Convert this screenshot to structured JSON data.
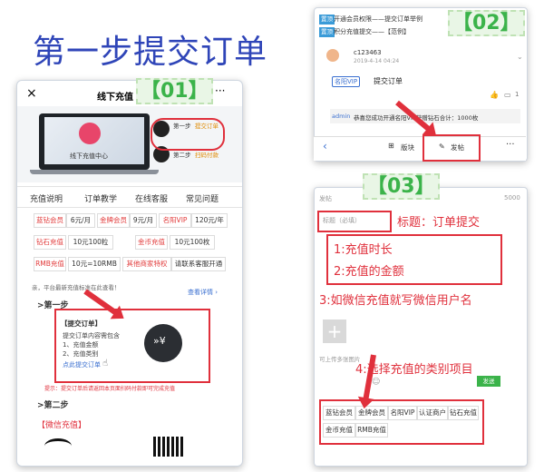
{
  "heading": "第一步提交订单",
  "labels": {
    "p1": "【01】",
    "p2": "【02】",
    "p3": "【03】"
  },
  "phone1": {
    "close": "×",
    "title": "线下充值",
    "more": "···",
    "laptop_caption": "线下充值中心",
    "step1_small": "第一步",
    "step1_text": "提交订单",
    "step2_small": "第二步",
    "step2_text": "扫码付款",
    "tabs": [
      "充值说明",
      "订单教学",
      "在线客服",
      "常见问题"
    ],
    "price_rows": [
      [
        "蓝钻会员",
        "6元/月",
        "金牌会员",
        "9元/月",
        "名阳VIP",
        "120元/年"
      ],
      [
        "钻石充值",
        "10元100粒",
        "",
        "金币充值",
        "10元100枚"
      ],
      [
        "RMB充值",
        "10元=10RMB",
        "其他商家特权",
        "请联系客服开通"
      ]
    ],
    "notice": "亲，平台最新充值标准在此查看！",
    "notice_link": "查看详情 ›",
    "step1_head": ">第一步",
    "card_title": "【提交订单】",
    "card_lines": [
      "提交订单内容需包含",
      "1、充值金额",
      "2、充值类别"
    ],
    "card_link": "点此提交订单",
    "warn": "提示：提交订单后请返回本页面扫码付款即可完成充值",
    "step2_head": ">第二步",
    "wechat": "【微信充值】"
  },
  "phone2": {
    "top_tag1": "置顶",
    "top_line1": "开通会员权限——提交订单举例",
    "top_tag2": "置顶",
    "top_line2": "积分充值提交——【范例】",
    "user": "c123463",
    "date": "2019-4-14 04:24",
    "vip_badge": "名阳VIP",
    "post_title": "提交订单",
    "reply_count": "1",
    "reply_user": "admin",
    "reply_text": "恭喜您成功开通名阳VIP获赠钻石合计：1000枚",
    "bar_section": "版块",
    "bar_post": "发帖",
    "bar_more": "···"
  },
  "phone3": {
    "header": "发帖",
    "count": "5000",
    "title_placeholder": "标题（必填）",
    "title_note": "标题：订单提交",
    "content_lines": [
      "1:充值时长",
      "2:充值的金额"
    ],
    "wechat_note": "3:如微信充值就写微信用户名",
    "select_note": "4:选择充值的类别项目",
    "upload_hint": "可上传多张图片",
    "send": "发送",
    "categories": [
      "蓝钻会员",
      "金牌会员",
      "名阳VIP",
      "认证商户",
      "钻石充值",
      "金币充值",
      "RMB充值"
    ]
  }
}
